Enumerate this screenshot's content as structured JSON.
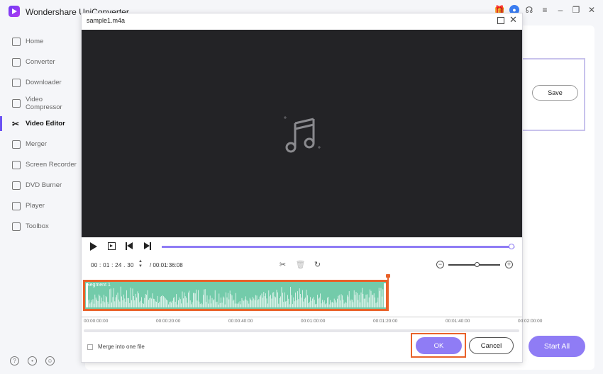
{
  "app": {
    "title": "Wondershare UniConverter"
  },
  "sidebar": {
    "items": [
      {
        "label": "Home",
        "icon": "home-icon"
      },
      {
        "label": "Converter",
        "icon": "converter-icon"
      },
      {
        "label": "Downloader",
        "icon": "downloader-icon"
      },
      {
        "label": "Video Compressor",
        "icon": "compressor-icon"
      },
      {
        "label": "Video Editor",
        "icon": "scissors-icon",
        "active": true
      },
      {
        "label": "Merger",
        "icon": "merger-icon"
      },
      {
        "label": "Screen Recorder",
        "icon": "recorder-icon"
      },
      {
        "label": "DVD Burner",
        "icon": "dvd-icon"
      },
      {
        "label": "Player",
        "icon": "player-icon"
      },
      {
        "label": "Toolbox",
        "icon": "toolbox-icon"
      }
    ]
  },
  "background": {
    "save_label": "Save",
    "start_all_label": "Start All"
  },
  "dialog": {
    "title": "sample1.m4a",
    "time_current": "00 : 01 : 24 . 30",
    "time_total": "/ 00:01:36:08",
    "progress": 0.99,
    "zoom_level": 0.55,
    "segment_label": "Segment 1",
    "ruler_ticks": [
      "00:00:00:00",
      "00:00:20:00",
      "00:00:40:00",
      "00:01:00:00",
      "00:01:20:00",
      "00:01:40:00",
      "00:02:00:00"
    ],
    "merge_label": "Merge into one file",
    "ok_label": "OK",
    "cancel_label": "Cancel"
  },
  "colors": {
    "accent": "#8f7cf5",
    "highlight": "#e9622a",
    "waveform": "#73cbaa",
    "preview_bg": "#232326"
  }
}
